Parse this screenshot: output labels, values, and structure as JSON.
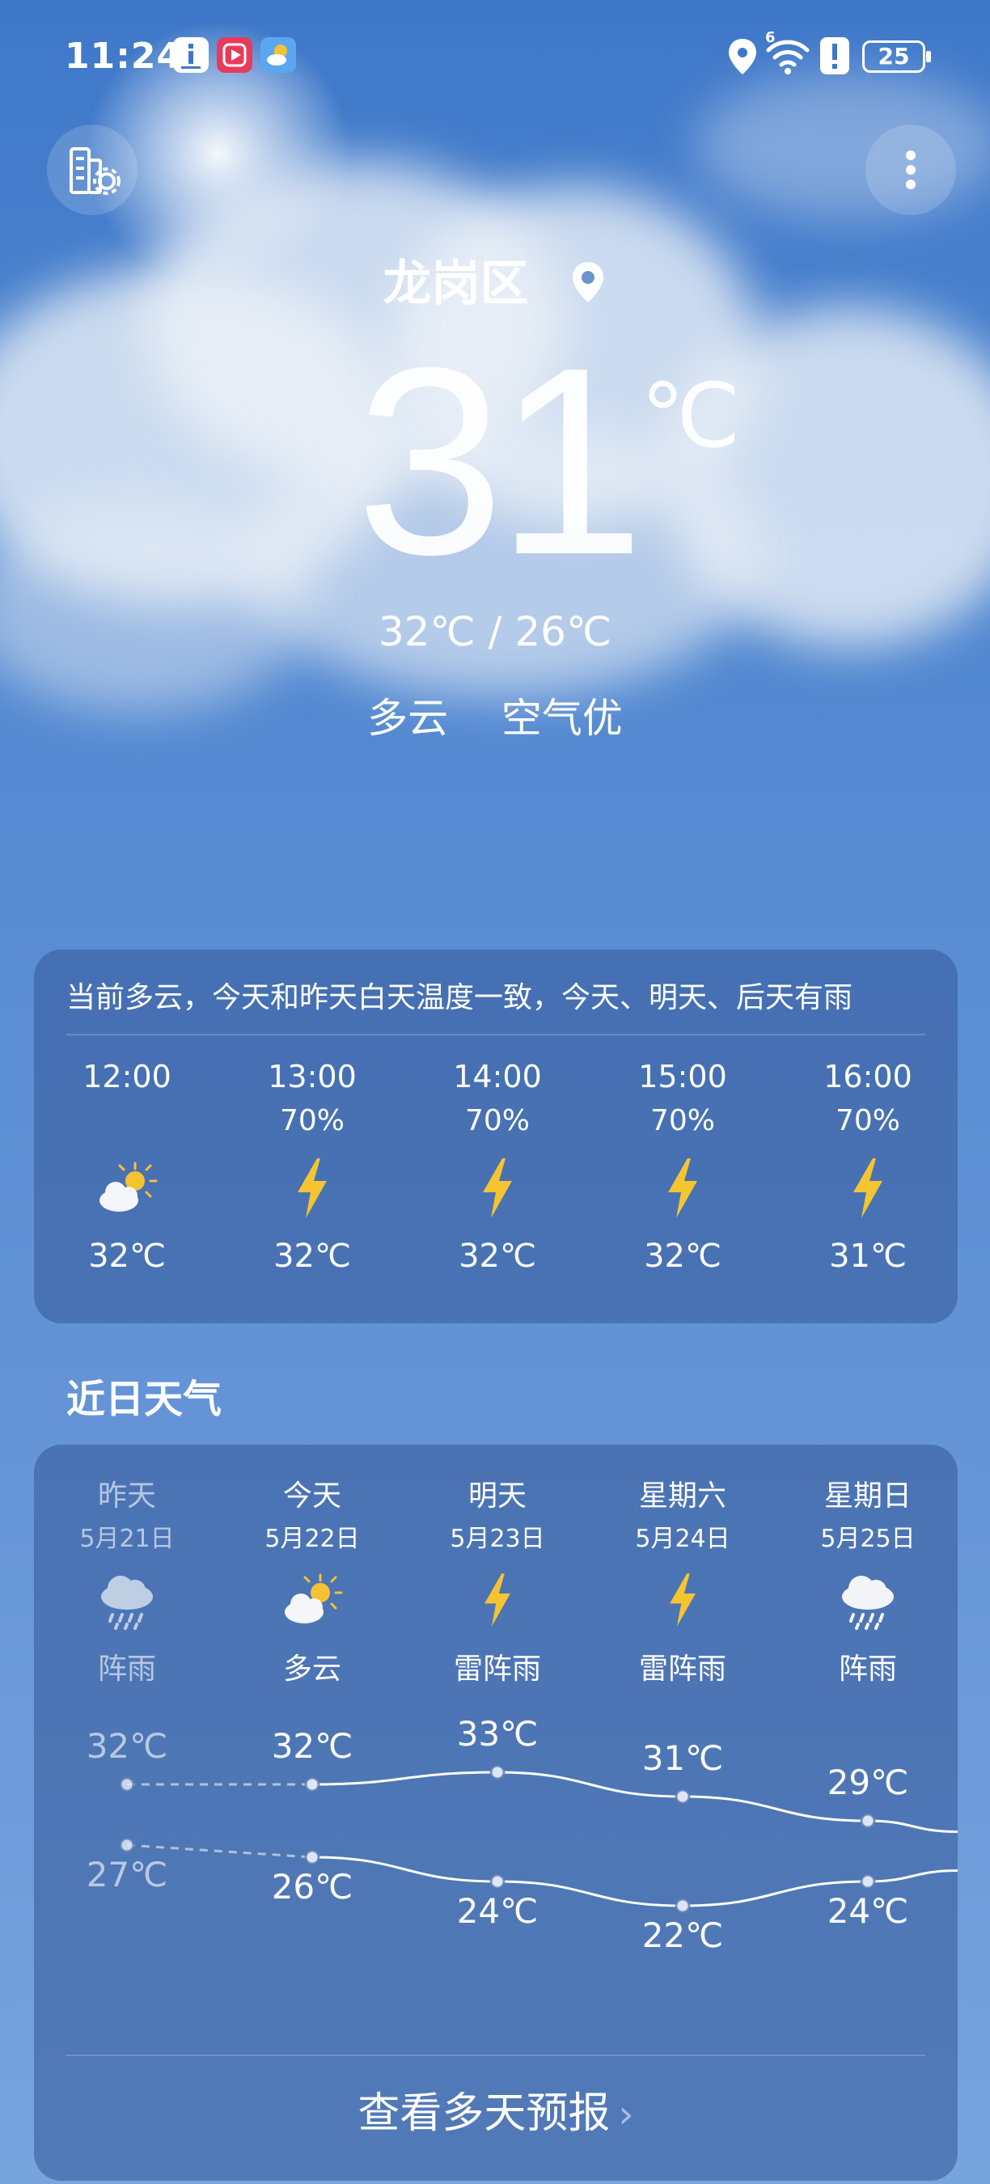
{
  "status_bar": {
    "time": "11:24",
    "battery": "25",
    "signal_label": "6"
  },
  "location": {
    "name": "龙岗区"
  },
  "current": {
    "temperature": "31",
    "unit": "℃",
    "hi_lo": "32℃ / 26℃",
    "condition": "多云",
    "air_quality": "空气优"
  },
  "hourly": {
    "summary": "当前多云，今天和昨天白天温度一致，今天、明天、后天有雨",
    "items": [
      {
        "time": "12:00",
        "precip": "",
        "icon": "sun-cloud-icon",
        "temp": "32℃"
      },
      {
        "time": "13:00",
        "precip": "70%",
        "icon": "lightning-icon",
        "temp": "32℃"
      },
      {
        "time": "14:00",
        "precip": "70%",
        "icon": "lightning-icon",
        "temp": "32℃"
      },
      {
        "time": "15:00",
        "precip": "70%",
        "icon": "lightning-icon",
        "temp": "32℃"
      },
      {
        "time": "16:00",
        "precip": "70%",
        "icon": "lightning-icon",
        "temp": "31℃"
      }
    ]
  },
  "daily": {
    "title": "近日天气",
    "days": [
      {
        "name": "昨天",
        "date": "5月21日",
        "icon": "shower-icon",
        "condition": "阵雨",
        "high": "32℃",
        "low": "27℃",
        "high_value": 32,
        "low_value": 27,
        "past": true
      },
      {
        "name": "今天",
        "date": "5月22日",
        "icon": "sun-cloud-icon",
        "condition": "多云",
        "high": "32℃",
        "low": "26℃",
        "high_value": 32,
        "low_value": 26,
        "past": false
      },
      {
        "name": "明天",
        "date": "5月23日",
        "icon": "lightning-icon",
        "condition": "雷阵雨",
        "high": "33℃",
        "low": "24℃",
        "high_value": 33,
        "low_value": 24,
        "past": false
      },
      {
        "name": "星期六",
        "date": "5月24日",
        "icon": "lightning-icon",
        "condition": "雷阵雨",
        "high": "31℃",
        "low": "22℃",
        "high_value": 31,
        "low_value": 22,
        "past": false
      },
      {
        "name": "星期日",
        "date": "5月25日",
        "icon": "shower-icon",
        "condition": "阵雨",
        "high": "29℃",
        "low": "24℃",
        "high_value": 29,
        "low_value": 24,
        "past": false
      }
    ],
    "more_label": "查看多天预报"
  },
  "colors": {
    "sky_top": "#3f78c9",
    "card_bg": "rgba(55,92,155,0.58)",
    "lightning": "#f4c431",
    "sun": "#f6c232"
  }
}
